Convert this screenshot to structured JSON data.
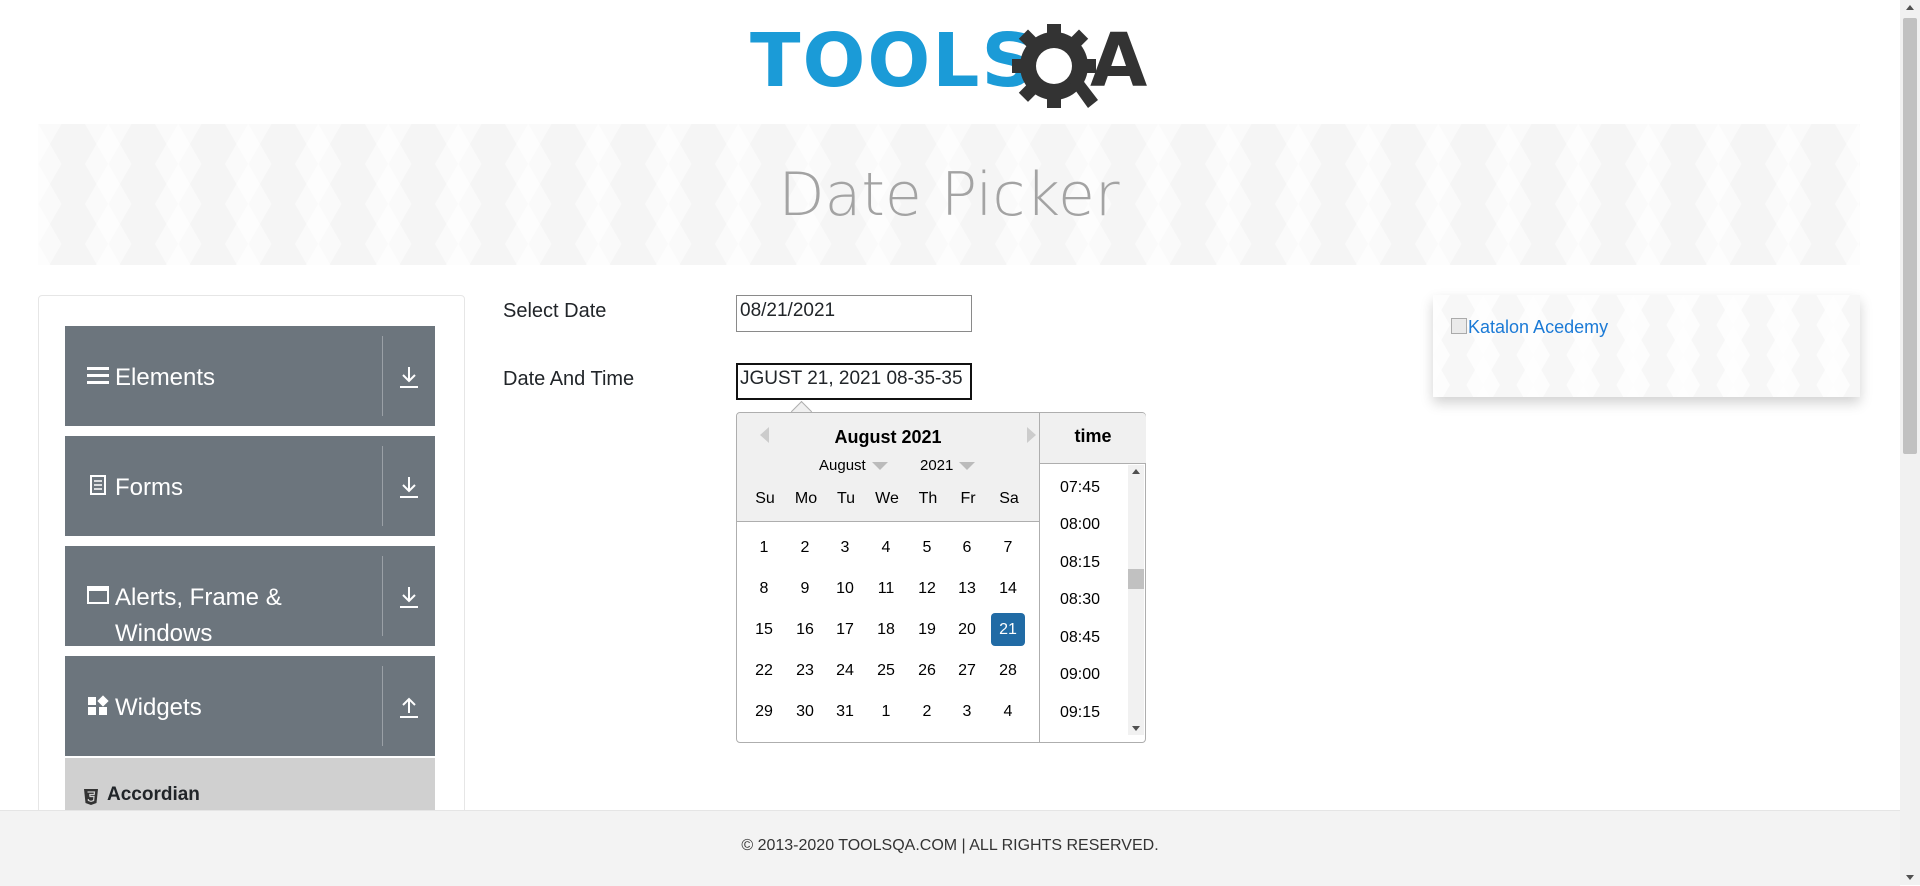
{
  "header": {
    "logo_text": "TOOLS",
    "logo_suffix": "A"
  },
  "banner": {
    "title": "Date Picker"
  },
  "sidebar": {
    "groups": [
      {
        "label": "Elements",
        "icon": "menu-icon",
        "arrow": "download-icon"
      },
      {
        "label": "Forms",
        "icon": "document-icon",
        "arrow": "download-icon"
      },
      {
        "label": "Alerts, Frame & Windows",
        "icon": "window-icon",
        "arrow": "download-icon"
      },
      {
        "label": "Widgets",
        "icon": "widgets-icon",
        "arrow": "upload-icon"
      }
    ],
    "subitems": [
      {
        "label": "Accordian",
        "icon": "html5-icon"
      }
    ]
  },
  "form": {
    "select_date_label": "Select Date",
    "select_date_value": "08/21/2021",
    "date_time_label": "Date And Time",
    "date_time_value": "JGUST  21, 2021 08-35-35"
  },
  "calendar": {
    "title": "August 2021",
    "month_select": "August",
    "year_select": "2021",
    "weekdays": [
      "Su",
      "Mo",
      "Tu",
      "We",
      "Th",
      "Fr",
      "Sa"
    ],
    "weeks": [
      [
        "1",
        "2",
        "3",
        "4",
        "5",
        "6",
        "7"
      ],
      [
        "8",
        "9",
        "10",
        "11",
        "12",
        "13",
        "14"
      ],
      [
        "15",
        "16",
        "17",
        "18",
        "19",
        "20",
        "21"
      ],
      [
        "22",
        "23",
        "24",
        "25",
        "26",
        "27",
        "28"
      ],
      [
        "29",
        "30",
        "31",
        "1",
        "2",
        "3",
        "4"
      ]
    ],
    "selected_day": "21",
    "time_title": "time",
    "times": [
      "07:45",
      "08:00",
      "08:15",
      "08:30",
      "08:45",
      "09:00",
      "09:15"
    ]
  },
  "ad": {
    "alt_text": "Katalon Acedemy"
  },
  "footer": {
    "text": "© 2013-2020 TOOLSQA.COM | ALL RIGHTS RESERVED."
  },
  "colors": {
    "brand_blue": "#1b9bd7",
    "nav_gray": "#6c757d",
    "selected_day": "#216ba5"
  }
}
